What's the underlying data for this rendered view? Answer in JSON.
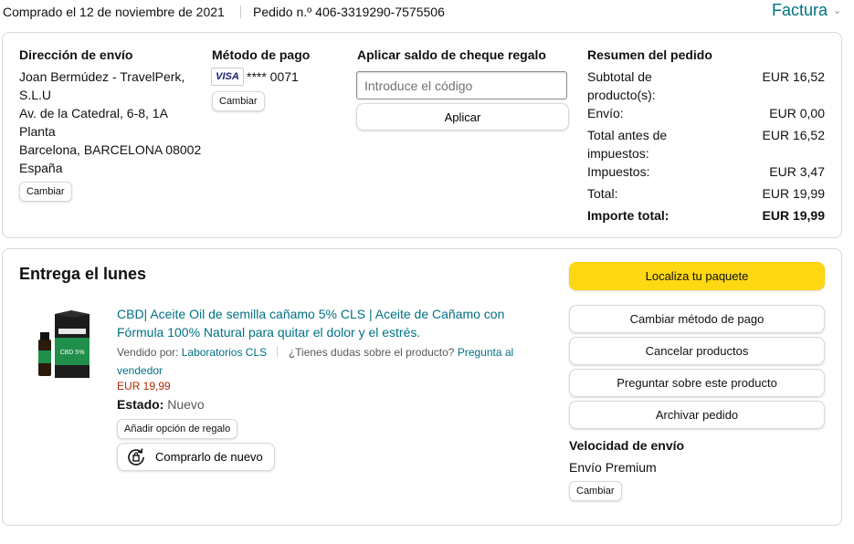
{
  "header": {
    "purchase_date": "Comprado el 12 de noviembre de 2021",
    "order_number": "Pedido n.º 406-3319290-7575506",
    "invoice_label": "Factura"
  },
  "shipping": {
    "title": "Dirección de envío",
    "lines": [
      "Joan Bermúdez - TravelPerk,",
      "S.L.U",
      "Av. de la Catedral, 6-8, 1A",
      "Planta",
      "Barcelona, BARCELONA 08002",
      "España"
    ],
    "change_label": "Cambiar"
  },
  "payment": {
    "title": "Método de pago",
    "card_brand": "VISA",
    "card_number": "**** 0071",
    "change_label": "Cambiar"
  },
  "gift_card": {
    "title": "Aplicar saldo de cheque regalo",
    "placeholder": "Introduce el código",
    "apply_label": "Aplicar"
  },
  "summary": {
    "title": "Resumen del pedido",
    "rows": [
      {
        "label": "Subtotal de producto(s):",
        "value": "EUR 16,52"
      },
      {
        "label": "Envío:",
        "value": "EUR 0,00"
      },
      {
        "label": "Total antes de impuestos:",
        "value": "EUR 16,52"
      },
      {
        "label": "Impuestos:",
        "value": "EUR 3,47"
      },
      {
        "label": "Total:",
        "value": "EUR 19,99"
      }
    ],
    "grand_total_label": "Importe total:",
    "grand_total_value": "EUR 19,99"
  },
  "delivery": {
    "title": "Entrega el lunes",
    "product": {
      "name": "CBD| Aceite Oil de semilla cañamo 5% CLS | Aceite de Cañamo con Fórmula 100% Natural para quitar el dolor y el estrés.",
      "sold_by_label": "Vendido por:",
      "seller": "Laboratorios CLS",
      "question_text": "¿Tienes dudas sobre el producto?",
      "ask_seller": "Pregunta al vendedor",
      "price": "EUR 19,99",
      "condition_label": "Estado:",
      "condition_value": "Nuevo",
      "gift_option_label": "Añadir opción de regalo",
      "buy_again_label": "Comprarlo de nuevo",
      "image_label": "CBD 5%"
    },
    "actions": {
      "track": "Localiza tu paquete",
      "change_payment": "Cambiar método de pago",
      "cancel": "Cancelar productos",
      "ask": "Preguntar sobre este producto",
      "archive": "Archivar pedido"
    },
    "shipping_speed_title": "Velocidad de envío",
    "shipping_speed_value": "Envío Premium",
    "change_label": "Cambiar"
  },
  "colors": {
    "link": "#007185",
    "price": "#b12704",
    "primary_button": "#ffd814",
    "border": "#d5d9d9"
  }
}
